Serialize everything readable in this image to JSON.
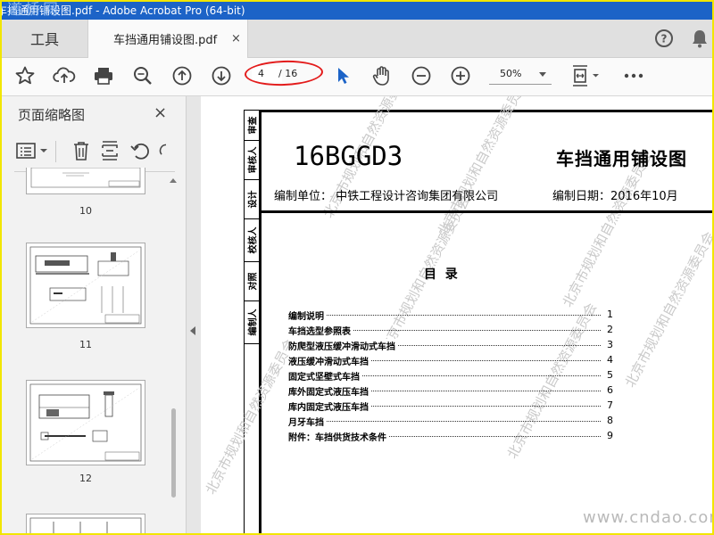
{
  "window": {
    "title": "车挡通用铺设图.pdf - Adobe Acrobat Pro (64-bit)",
    "overlay_watermark": "道桥网"
  },
  "tabs": {
    "tools_label": "工具",
    "document_label": "车挡通用铺设图.pdf",
    "close_glyph": "×"
  },
  "toolbar": {
    "icons": [
      "star-icon",
      "cloud-upload-icon",
      "print-icon",
      "zoom-search-icon",
      "arrow-up-icon",
      "arrow-down-icon",
      "select-cursor-icon",
      "hand-icon",
      "zoom-out-icon",
      "zoom-in-icon",
      "fit-page-icon",
      "more-icon"
    ],
    "current_page": "4",
    "total_pages": "/ 16",
    "zoom_value": "50%",
    "accent_color": "#1c63c7",
    "highlight_color": "#e31b1b"
  },
  "sidebar": {
    "title": "页面缩略图",
    "close_glyph": "×",
    "tools": [
      "page-options-icon",
      "delete-icon",
      "insert-page-icon",
      "undo-icon",
      "redo-icon"
    ],
    "thumbnails": [
      {
        "page": "10"
      },
      {
        "page": "11"
      },
      {
        "page": "12"
      }
    ]
  },
  "document": {
    "signature_cells": [
      "审查",
      "审核人",
      "设计",
      "校核人",
      "对照",
      "编制人"
    ],
    "code": "16BGGD3",
    "title": "车挡通用铺设图",
    "editor": "编制单位：  中铁工程设计咨询集团有限公司",
    "date": "编制日期：2016年10月",
    "toc_heading": "目  录",
    "toc": [
      {
        "text": "编制说明",
        "page": "1"
      },
      {
        "text": "车挡选型参照表",
        "page": "2"
      },
      {
        "text": "防爬型液压缓冲滑动式车挡",
        "page": "3"
      },
      {
        "text": "液压缓冲滑动式车挡",
        "page": "4"
      },
      {
        "text": "固定式坚壁式车挡",
        "page": "5"
      },
      {
        "text": "库外固定式液压车挡",
        "page": "6"
      },
      {
        "text": "库内固定式液压车挡",
        "page": "7"
      },
      {
        "text": "月牙车挡",
        "page": "8"
      },
      {
        "text": "附件：车挡供货技术条件",
        "page": "9"
      }
    ],
    "watermark_text": "北京市规划和自然资源委员会",
    "site_watermark": "www.cndao.com"
  }
}
